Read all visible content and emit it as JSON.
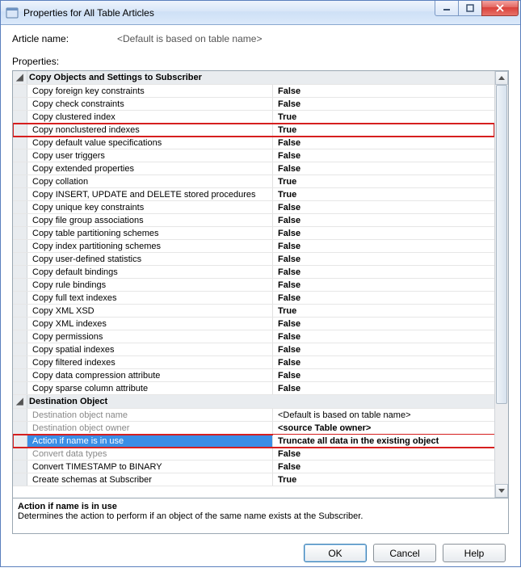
{
  "window": {
    "title": "Properties for All Table Articles"
  },
  "article": {
    "label": "Article name:",
    "value": "<Default is based on table name>"
  },
  "propsLabel": "Properties:",
  "catA": {
    "gutter": "◢",
    "label": "Copy Objects and Settings to Subscriber"
  },
  "rows": {
    "r0": {
      "name": "Copy foreign key constraints",
      "val": "False"
    },
    "r1": {
      "name": "Copy check constraints",
      "val": "False"
    },
    "r2": {
      "name": "Copy clustered index",
      "val": "True"
    },
    "r3": {
      "name": "Copy nonclustered indexes",
      "val": "True"
    },
    "r4": {
      "name": "Copy default value specifications",
      "val": "False"
    },
    "r5": {
      "name": "Copy user triggers",
      "val": "False"
    },
    "r6": {
      "name": "Copy extended properties",
      "val": "False"
    },
    "r7": {
      "name": "Copy collation",
      "val": "True"
    },
    "r8": {
      "name": "Copy INSERT, UPDATE and DELETE stored procedures",
      "val": "True"
    },
    "r9": {
      "name": "Copy unique key constraints",
      "val": "False"
    },
    "r10": {
      "name": "Copy file group associations",
      "val": "False"
    },
    "r11": {
      "name": "Copy table partitioning schemes",
      "val": "False"
    },
    "r12": {
      "name": "Copy index partitioning schemes",
      "val": "False"
    },
    "r13": {
      "name": "Copy user-defined statistics",
      "val": "False"
    },
    "r14": {
      "name": "Copy default bindings",
      "val": "False"
    },
    "r15": {
      "name": "Copy rule bindings",
      "val": "False"
    },
    "r16": {
      "name": "Copy full text indexes",
      "val": "False"
    },
    "r17": {
      "name": "Copy XML XSD",
      "val": "True"
    },
    "r18": {
      "name": "Copy XML indexes",
      "val": "False"
    },
    "r19": {
      "name": "Copy permissions",
      "val": "False"
    },
    "r20": {
      "name": "Copy spatial indexes",
      "val": "False"
    },
    "r21": {
      "name": "Copy filtered indexes",
      "val": "False"
    },
    "r22": {
      "name": "Copy data compression attribute",
      "val": "False"
    },
    "r23": {
      "name": "Copy sparse column attribute",
      "val": "False"
    }
  },
  "catB": {
    "gutter": "◢",
    "label": "Destination Object"
  },
  "drows": {
    "d0": {
      "name": "Destination object name",
      "val": "<Default is based on table name>"
    },
    "d1": {
      "name": "Destination object owner",
      "val": "<source Table owner>"
    },
    "d2": {
      "name": "Action if name is in use",
      "val": "Truncate all data in the existing object"
    },
    "d3": {
      "name": "Convert data types",
      "val": "False"
    },
    "d4": {
      "name": "Convert TIMESTAMP to BINARY",
      "val": "False"
    },
    "d5": {
      "name": "Create schemas at Subscriber",
      "val": "True"
    }
  },
  "desc": {
    "title": "Action if name is in use",
    "text": "Determines the action to perform if an object of the same name exists at the Subscriber."
  },
  "buttons": {
    "ok": "OK",
    "cancel": "Cancel",
    "help": "Help"
  }
}
